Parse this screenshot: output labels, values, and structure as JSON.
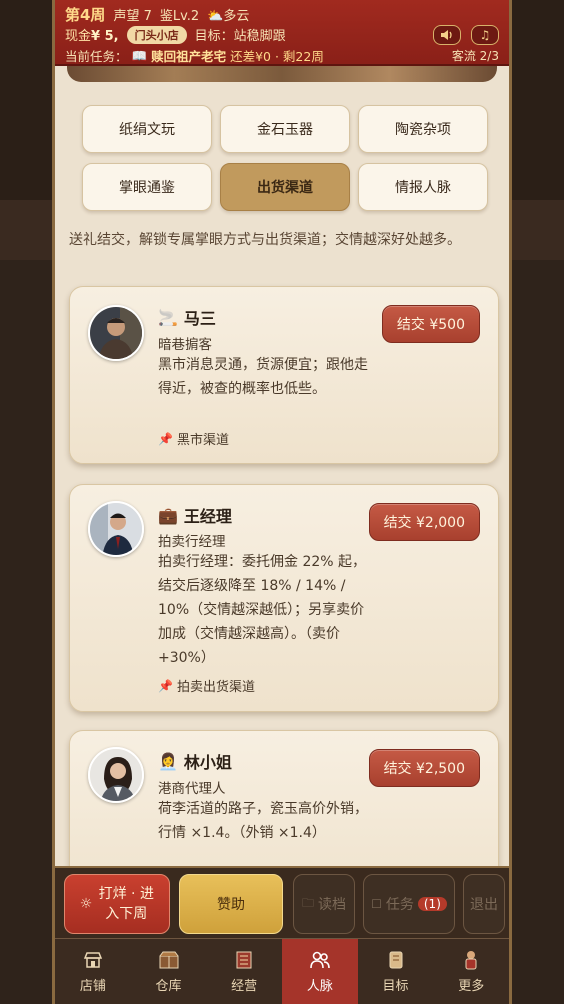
{
  "header": {
    "week": "第4周",
    "reputation": "声望 7",
    "appraisal": "鉴Lv.2",
    "weather": "多云",
    "cash_label": "现金",
    "cash_value": "¥ 5,",
    "shop_tag": "门头小店",
    "goal": "目标：站稳脚跟",
    "task_label": "当前任务：",
    "task_name": "赎回祖产老宅",
    "task_remain": "还差¥0 · 剩22周",
    "traffic": "客流 2/3",
    "sound_icon": "speaker-icon",
    "music_icon": "music-note-icon"
  },
  "tabs": [
    {
      "label": "纸绢文玩"
    },
    {
      "label": "金石玉器"
    },
    {
      "label": "陶瓷杂项"
    },
    {
      "label": "掌眼通鉴"
    },
    {
      "label": "出货渠道",
      "active": true
    },
    {
      "label": "情报人脉"
    }
  ],
  "intro": "送礼结交，解锁专属掌眼方式与出货渠道；交情越深好处越多。",
  "contacts": [
    {
      "emoji": "🚬",
      "name": "马三",
      "role": "暗巷掮客",
      "desc": "黑市消息灵通，货源便宜；跟他走得近，被查的概率也低些。",
      "channel": "黑市渠道",
      "button": "结交 ¥500"
    },
    {
      "emoji": "💼",
      "name": "王经理",
      "role": "拍卖行经理",
      "desc": "拍卖行经理：委托佣金 22% 起，结交后逐级降至 18% / 14% / 10%（交情越深越低）；另享卖价加成（交情越深越高）。（卖价+30%）",
      "channel": "拍卖出货渠道",
      "button": "结交 ¥2,000"
    },
    {
      "emoji": "👩‍💼",
      "name": "林小姐",
      "role": "港商代理人",
      "desc": "荷李活道的路子，瓷玉高价外销，行情 ×1.4。（外销 ×1.4）",
      "channel": "",
      "button": "结交 ¥2,500"
    }
  ],
  "actions": {
    "next_week": "打烊 · 进入下周",
    "sponsor": "赞助",
    "load": "读档",
    "task": "任务",
    "task_count": "(1)",
    "exit": "退出"
  },
  "nav": [
    {
      "label": "店铺",
      "icon": "shop-icon"
    },
    {
      "label": "仓库",
      "icon": "warehouse-icon"
    },
    {
      "label": "经营",
      "icon": "ledger-icon"
    },
    {
      "label": "人脉",
      "icon": "people-icon",
      "active": true
    },
    {
      "label": "目标",
      "icon": "scroll-icon"
    },
    {
      "label": "更多",
      "icon": "more-icon"
    }
  ]
}
